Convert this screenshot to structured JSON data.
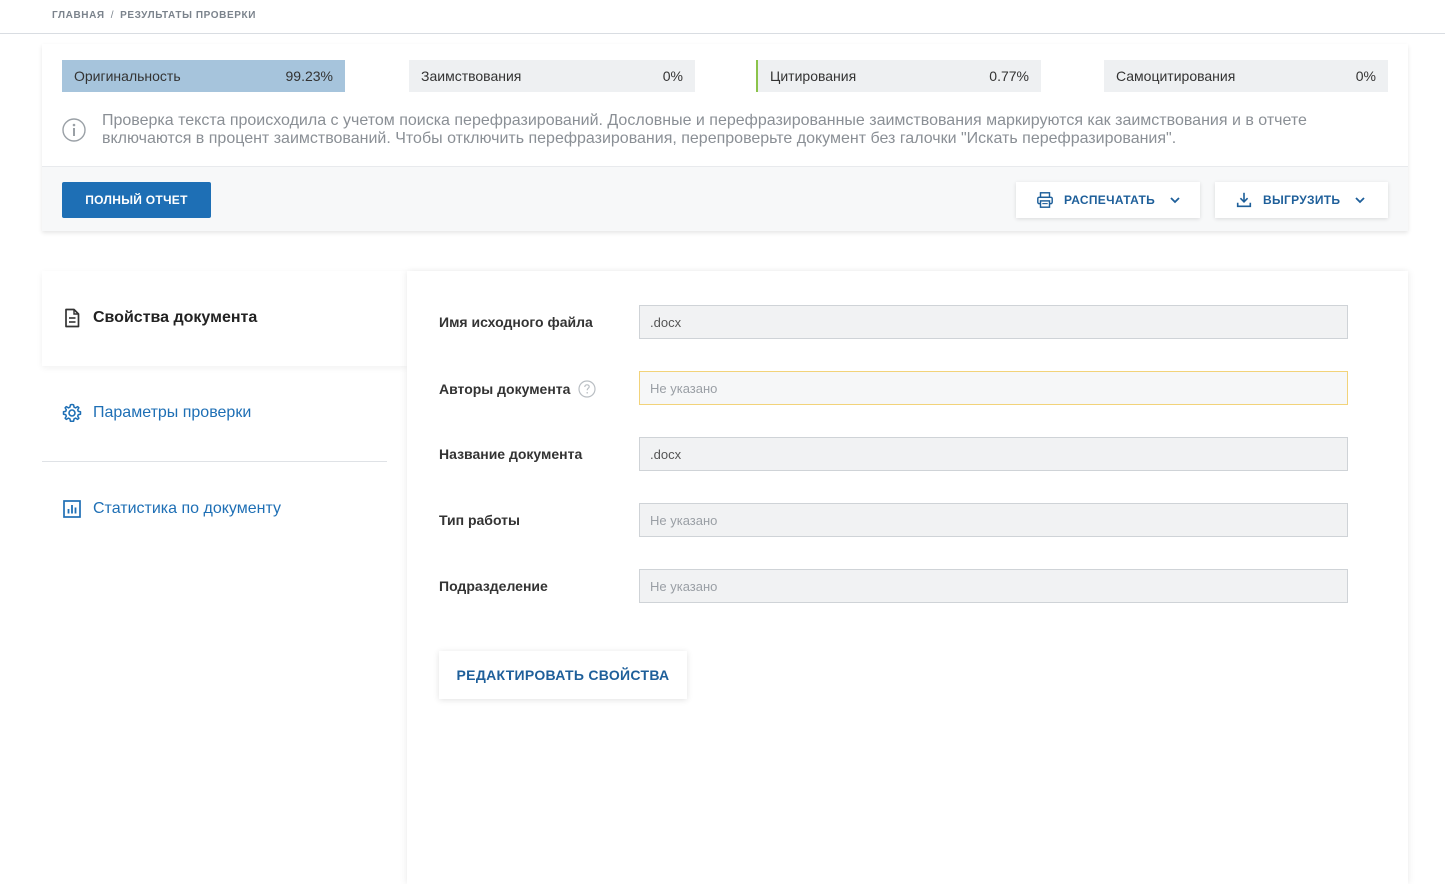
{
  "breadcrumb": {
    "home": "ГЛАВНАЯ",
    "separator": "/",
    "current": "РЕЗУЛЬТАТЫ ПРОВЕРКИ"
  },
  "metrics": {
    "originality": {
      "label": "Оригинальность",
      "value": "99.23%",
      "fill": 0.9923
    },
    "borrowings": {
      "label": "Заимствования",
      "value": "0%"
    },
    "citations": {
      "label": "Цитирования",
      "value": "0.77%"
    },
    "self_citations": {
      "label": "Самоцитирования",
      "value": "0%"
    }
  },
  "info": {
    "text": "Проверка текста происходила с учетом поиска перефразирований. Дословные и перефразированные заимствования маркируются как заимствования и в отчете включаются в процент заимствований. Чтобы отключить перефразирования, перепроверьте документ без галочки \"Искать перефразирования\"."
  },
  "toolbar": {
    "full_report": "ПОЛНЫЙ ОТЧЕТ",
    "print": "РАСПЕЧАТАТЬ",
    "export": "ВЫГРУЗИТЬ"
  },
  "sidebar": {
    "items": [
      {
        "label": "Свойства документа",
        "icon": "document-icon",
        "active": true
      },
      {
        "label": "Параметры проверки",
        "icon": "gear-icon",
        "active": false
      },
      {
        "label": "Статистика по документу",
        "icon": "chart-icon",
        "active": false
      }
    ]
  },
  "fields": [
    {
      "label": "Имя исходного файла",
      "value": ".docx",
      "placeholder": ""
    },
    {
      "label": "Авторы документа",
      "value": "",
      "placeholder": "Не указано"
    },
    {
      "label": "Название документа",
      "value": ".docx",
      "placeholder": ""
    },
    {
      "label": "Тип работы",
      "value": "",
      "placeholder": "Не указано"
    },
    {
      "label": "Подразделение",
      "value": "",
      "placeholder": "Не указано"
    }
  ],
  "edit_button": "РЕДАКТИРОВАТЬ СВОЙСТВА",
  "colors": {
    "accent": "#1e6fb5",
    "originality_bar": "#a6c4dc",
    "citation_marker": "#8bc34a",
    "focus_border": "#f2d37a"
  }
}
